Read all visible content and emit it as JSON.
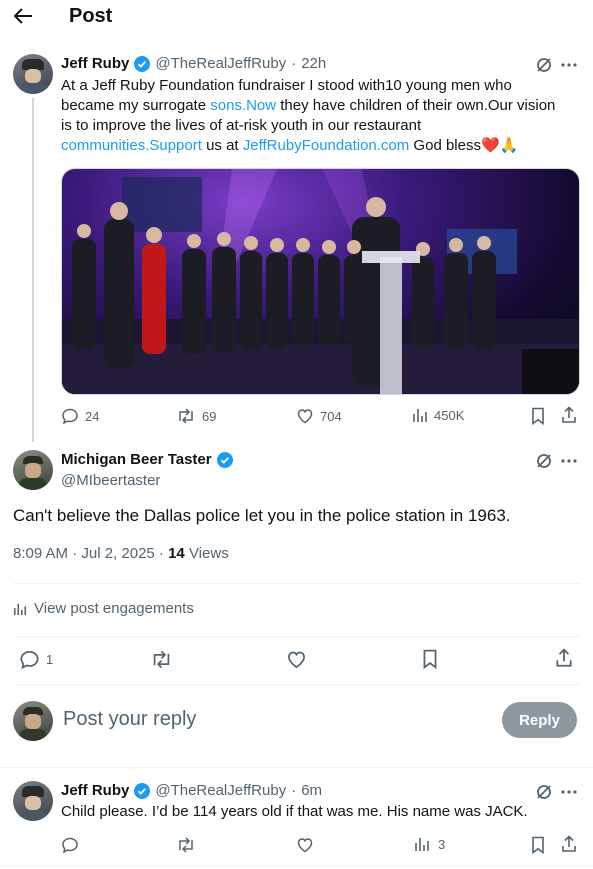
{
  "header": {
    "title": "Post",
    "back_icon": "arrow-left-icon"
  },
  "original_post": {
    "author_name": "Jeff Ruby",
    "handle": "@TheRealJeffRuby",
    "time": "22h",
    "text": {
      "l1": "At a Jeff Ruby Foundation fundraiser I stood with10 young men who",
      "l2a": "became my surrogate ",
      "l2link": "sons.Now",
      "l2b": " they have children of their own.Our vision",
      "l3": "is to improve the lives of at-risk youth in our  restaurant",
      "l4link1": "communities.Support",
      "l4mid": " us at ",
      "l4link2": "JeffRubyFoundation.com",
      "l4tail": " God bless",
      "emoji": "❤️🙏"
    },
    "stats": {
      "replies": "24",
      "reposts": "69",
      "likes": "704",
      "views": "450K"
    }
  },
  "reply": {
    "author_name": "Michigan Beer Taster",
    "handle": "@MIbeertaster",
    "text": "Can't believe the Dallas police let you in the police station in 1963.",
    "time": "8:09 AM · Jul 2, 2025 · ",
    "views_count": "14",
    "views_label": " Views",
    "engagements": "View post engagements",
    "stats": {
      "replies": "1"
    }
  },
  "composer": {
    "placeholder": "Post your reply",
    "button": "Reply"
  },
  "second_reply": {
    "author_name": "Jeff Ruby",
    "handle": "@TheRealJeffRuby",
    "time": "6m",
    "text": "Child please.  I’d be 114 years old if that was me. His name was JACK.",
    "stats": {
      "views": "3"
    }
  },
  "colors": {
    "accent": "#1d9bf0",
    "verified": "#1d9bf0",
    "muted": "#536471",
    "heart": "#e0245e"
  }
}
